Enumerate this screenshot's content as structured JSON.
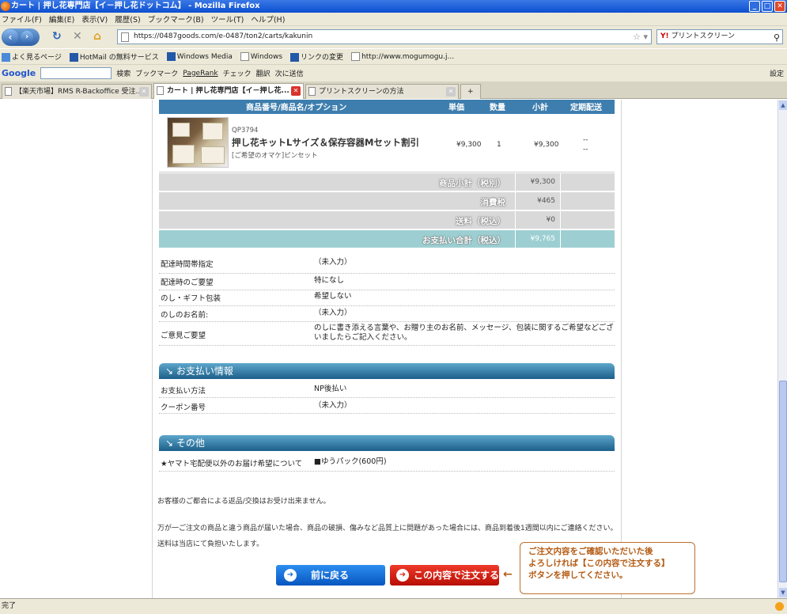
{
  "window": {
    "title": "カート | 押し花専門店【イ－押し花ドットコム】 - Mozilla Firefox"
  },
  "menu": [
    "ファイル(F)",
    "編集(E)",
    "表示(V)",
    "履歴(S)",
    "ブックマーク(B)",
    "ツール(T)",
    "ヘルプ(H)"
  ],
  "nav": {
    "url": "https://0487goods.com/e-0487/ton2/carts/kakunin",
    "search_text": "プリントスクリーン",
    "search_brand": "Y!"
  },
  "bookmarks": [
    "よく見るページ",
    "HotMail の無料サービス",
    "Windows Media",
    "Windows",
    "リンクの変更",
    "http://www.mogumogu.j..."
  ],
  "google_toolbar": {
    "logo": "Google",
    "items": [
      "検索",
      "ブックマーク",
      "PageRank",
      "チェック",
      "翻訳",
      "次に送信"
    ],
    "settings": "設定"
  },
  "tabs": [
    {
      "label": "【楽天市場】RMS R-Backoffice 受注..."
    },
    {
      "label": "カート | 押し花専門店【イ－押し花..."
    },
    {
      "label": "プリントスクリーンの方法"
    }
  ],
  "status": {
    "text": "完了"
  },
  "cart": {
    "headers": {
      "item": "商品番号/商品名/オプション",
      "price": "単価",
      "qty": "数量",
      "subtotal": "小計",
      "regular": "定期配送"
    },
    "product": {
      "code": "QP3794",
      "name": "押し花キットLサイズ＆保存容器Mセット割引",
      "option": "[ご希望のオマケ]ピンセット",
      "price": "¥9,300",
      "qty": "1",
      "subtotal": "¥9,300",
      "regular_1": "--",
      "regular_2": "--"
    },
    "summary": [
      {
        "label": "商品小計（税別）",
        "value": "¥9,300"
      },
      {
        "label": "消費税",
        "value": "¥465"
      },
      {
        "label": "送料（税込）",
        "value": "¥0"
      },
      {
        "label": "お支払い合計（税込）",
        "value": "¥9,765"
      }
    ]
  },
  "delivery": [
    {
      "key": "配達時間帯指定",
      "value": "（未入力）"
    },
    {
      "key": "配達時のご要望",
      "value": "特になし"
    },
    {
      "key": "のし・ギフト包装",
      "value": "希望しない"
    },
    {
      "key": "のしのお名前:",
      "value": "（未入力）"
    },
    {
      "key": "ご意見ご要望",
      "value": "のしに書き添える言葉や、お贈り主のお名前、メッセージ、包装に関するご希望などございましたらご記入ください。"
    }
  ],
  "payment": {
    "title": "お支払い情報",
    "rows": [
      {
        "key": "お支払い方法",
        "value": "NP後払い"
      },
      {
        "key": "クーポン番号",
        "value": "（未入力）"
      }
    ]
  },
  "other": {
    "title": "その他",
    "rows": [
      {
        "key": "★ヤマト宅配便以外のお届け希望について",
        "value": "■ゆうパック(600円)"
      }
    ]
  },
  "notes": {
    "n1": "お客様のご都合による返品/交換はお受け出来ません。",
    "n2": "万が一ご注文の商品と違う商品が届いた場合、商品の破損、傷みなど品質上に問題があった場合には、商品到着後1週間以内にご連絡ください。",
    "n3": "送料は当店にて負担いたします。"
  },
  "buttons": {
    "back": "前に戻る",
    "order": "この内容で注文する"
  },
  "callout": {
    "line1": "ご注文内容をご確認いただいた後",
    "line2": "よろしければ【この内容で注文する】",
    "line3": "ボタンを押してください。"
  },
  "colors": {
    "accent_blue": "#1c5f8a",
    "total_row": "#9dcfd2",
    "order_red": "#d82a1a",
    "callout": "#b35a12"
  }
}
